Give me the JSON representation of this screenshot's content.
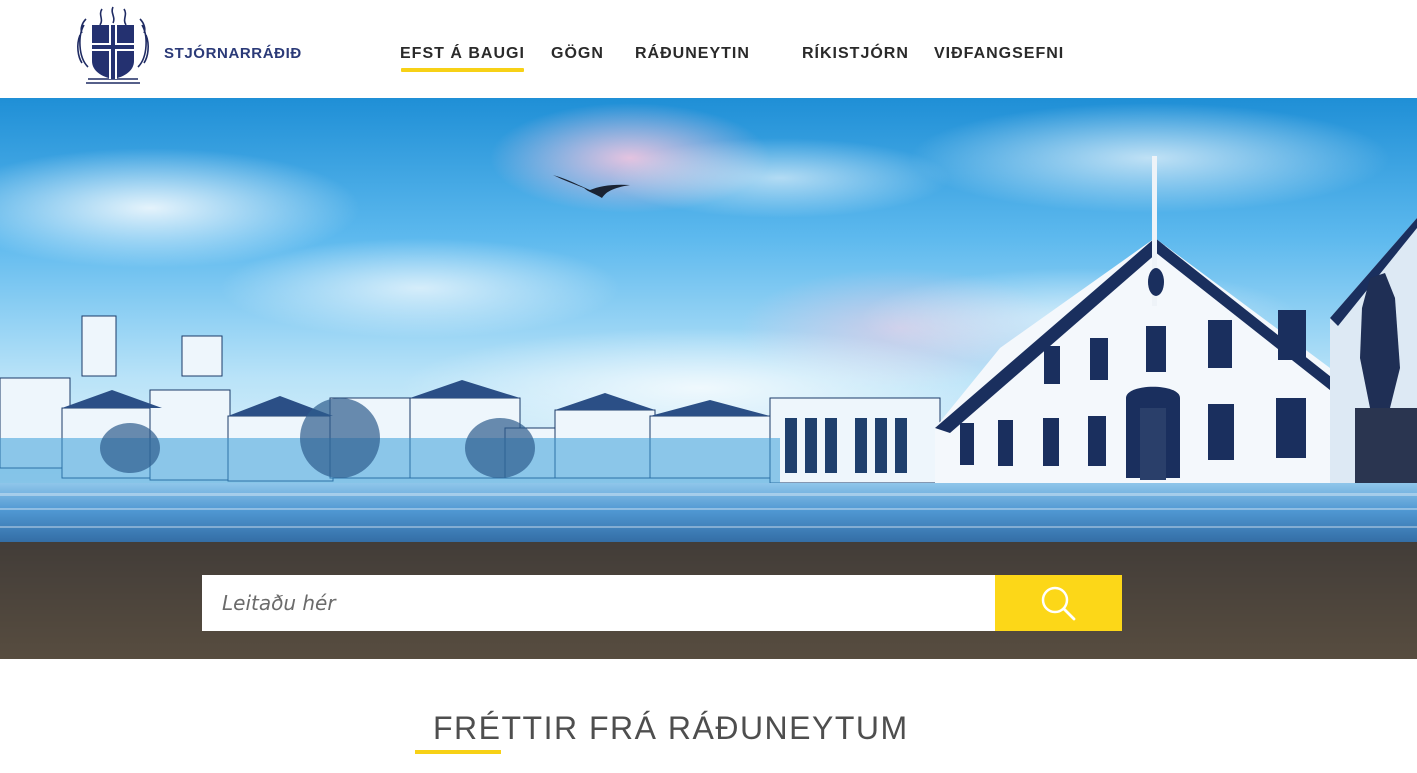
{
  "brand": {
    "name": "STJÓRNARRÁÐIÐ",
    "logo_icon": "coat-of-arms-icon"
  },
  "nav": {
    "items": [
      {
        "label": "EFST Á BAUGI",
        "active": true
      },
      {
        "label": "GÖGN",
        "active": false
      },
      {
        "label": "RÁÐUNEYTIN",
        "active": false
      },
      {
        "label": "RÍKISTJÓRN",
        "active": false
      },
      {
        "label": "VIÐFANGSEFNI",
        "active": false
      }
    ]
  },
  "search": {
    "placeholder": "Leitaðu hér",
    "button_icon": "search-icon"
  },
  "news": {
    "title": "FRÉTTIR FRÁ RÁÐUNEYTUM"
  },
  "colors": {
    "accent": "#f7d116",
    "brand_blue": "#2b3a78",
    "search_button": "#fcd718"
  }
}
